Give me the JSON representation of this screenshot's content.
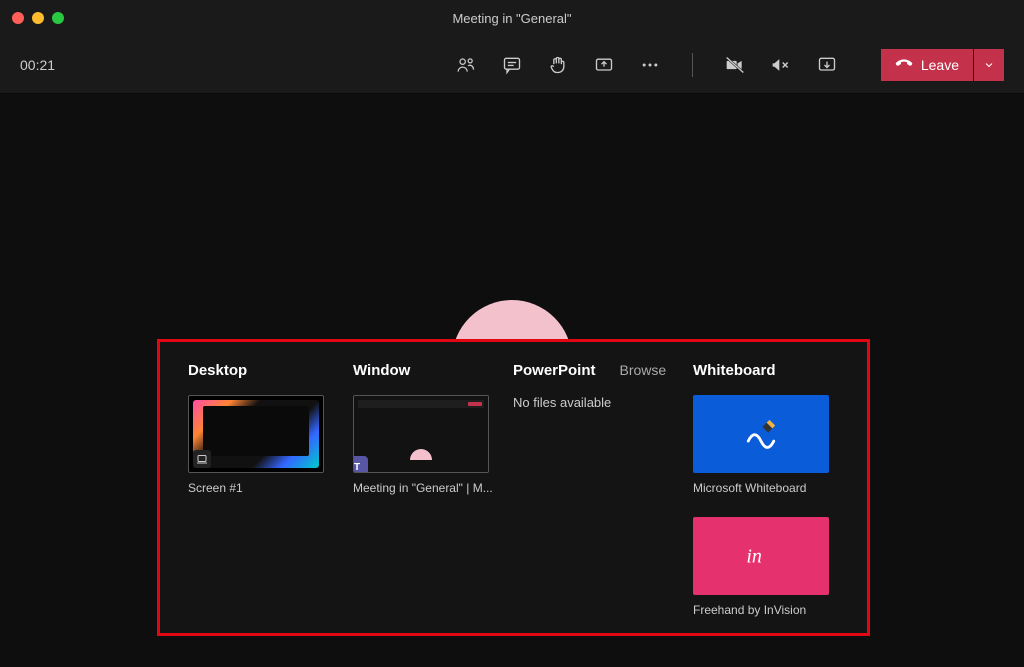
{
  "window": {
    "title": "Meeting in \"General\""
  },
  "toolbar": {
    "timer": "00:21",
    "leave_label": "Leave"
  },
  "share": {
    "headers": {
      "desktop": "Desktop",
      "window": "Window",
      "powerpoint": "PowerPoint",
      "browse": "Browse",
      "whiteboard": "Whiteboard"
    },
    "desktop_item": "Screen #1",
    "window_item": "Meeting in \"General\" | M...",
    "no_files": "No files available",
    "whiteboard_items": {
      "ms": "Microsoft Whiteboard",
      "invision": "Freehand by InVision"
    }
  }
}
